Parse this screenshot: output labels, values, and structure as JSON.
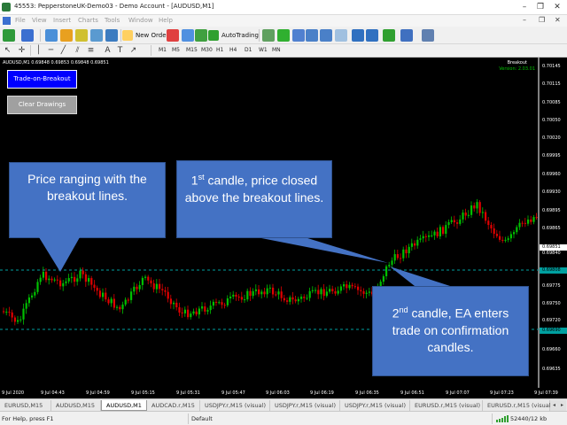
{
  "window": {
    "title": "45553: PepperstoneUK-Demo03 - Demo Account - [AUDUSD,M1]",
    "minimize": "–",
    "maximize": "❐",
    "close": "✕"
  },
  "menu": {
    "items": [
      "File",
      "View",
      "Insert",
      "Charts",
      "Tools",
      "Window",
      "Help"
    ],
    "doc_minimize": "–",
    "doc_restore": "❐",
    "doc_close": "✕"
  },
  "toolbar": {
    "new_order_label": "New Order",
    "autotrading_label": "AutoTrading"
  },
  "timeframes": [
    "M1",
    "M5",
    "M15",
    "M30",
    "H1",
    "H4",
    "D1",
    "W1",
    "MN"
  ],
  "chart": {
    "symbol_info": "AUDUSD,M1  0.69848 0.69853 0.69848 0.69851",
    "ea_name": "Breakout",
    "ea_version": "Version: 2.03.01",
    "buttons": {
      "trade_on_breakout": "Trade-on-Breakout",
      "clear_drawings": "Clear Drawings"
    },
    "callouts": {
      "ranging": "Price ranging with the breakout lines.",
      "first_candle_ord": "1",
      "first_candle_sup": "st",
      "first_candle_text": " candle, price closed above the breakout lines.",
      "second_candle_ord": "2",
      "second_candle_sup": "nd",
      "second_candle_text": " candle, EA enters trade on confirmation candles."
    },
    "price_labels": [
      "0.70145",
      "0.70115",
      "0.70085",
      "0.70050",
      "0.70020",
      "0.69995",
      "0.69960",
      "0.69930",
      "0.69895",
      "0.69865",
      "0.69851",
      "0.69840",
      "0.69808",
      "0.69775",
      "0.69750",
      "0.69720",
      "0.69690",
      "0.69660",
      "0.69635"
    ],
    "current_price": "0.69851",
    "upper_line_price": "0.69808",
    "lower_line_price": "0.69690",
    "time_labels": [
      "9 Jul 2020",
      "9 Jul 04:43",
      "9 Jul 04:59",
      "9 Jul 05:15",
      "9 Jul 05:31",
      "9 Jul 05:47",
      "9 Jul 06:03",
      "9 Jul 06:19",
      "9 Jul 06:35",
      "9 Jul 06:51",
      "9 Jul 07:07",
      "9 Jul 07:23",
      "9 Jul 07:39"
    ],
    "colors": {
      "bull": "#00c000",
      "bear": "#e00000",
      "background": "#000000",
      "breakout_line": "#00a0a0",
      "callout": "#4472c4",
      "button_active": "#0000ff"
    }
  },
  "tabs": [
    "EURUSD,M15",
    "AUDUSD,M15",
    "AUDUSD,M1",
    "AUDCAD.r,M15",
    "USDJPY.r,M15 (visual)",
    "USDJPY.r,M15 (visual)",
    "USDJPY.r,M15 (visual)",
    "EURUSD.r,M15 (visual)",
    "EURUSD.r,M15 (visual)"
  ],
  "tabs_active_index": 2,
  "status": {
    "help": "For Help, press F1",
    "profile": "Default",
    "connection": "52440/12 kb"
  }
}
